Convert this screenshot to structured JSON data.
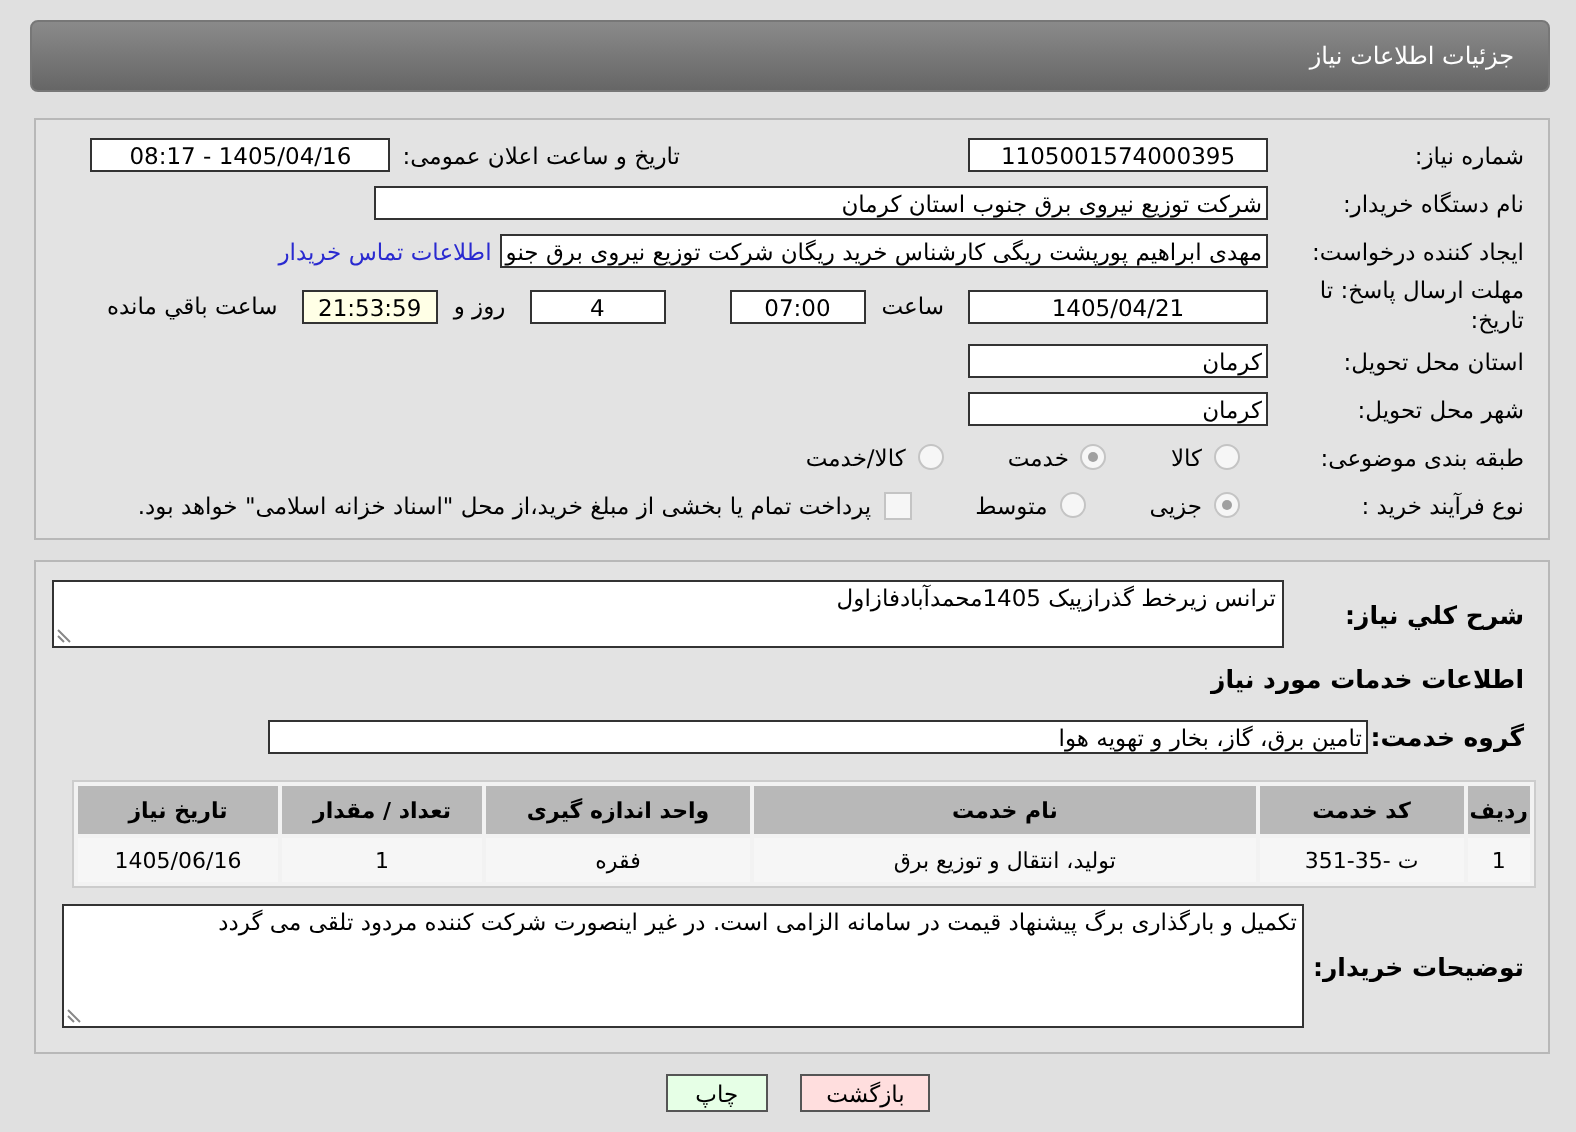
{
  "header": {
    "title": "جزئیات اطلاعات نیاز"
  },
  "need_number": {
    "label": "شماره نیاز:",
    "value": "1105001574000395"
  },
  "announce": {
    "label": "تاریخ و ساعت اعلان عمومی:",
    "value": "1405/04/16 - 08:17"
  },
  "buyer_org": {
    "label": "نام دستگاه خریدار:",
    "value": "شرکت توزیع نیروی برق جنوب استان کرمان"
  },
  "creator": {
    "label": "ایجاد کننده درخواست:",
    "value": "مهدی ابراهیم پورپشت ریگی کارشناس خرید ریگان شرکت توزیع نیروی برق جنو",
    "contact_link": "اطلاعات تماس خریدار"
  },
  "deadline": {
    "label": "مهلت ارسال پاسخ: تا تاریخ:",
    "date": "1405/04/21",
    "time_label": "ساعت",
    "time": "07:00",
    "days": "4",
    "days_label": "روز و",
    "remaining": "21:53:59",
    "remaining_label": "ساعت باقي مانده"
  },
  "province": {
    "label": "استان محل تحویل:",
    "value": "کرمان"
  },
  "city": {
    "label": "شهر محل تحویل:",
    "value": "کرمان"
  },
  "category": {
    "label": "طبقه بندی موضوعی:",
    "options": [
      {
        "label": "کالا",
        "selected": false
      },
      {
        "label": "خدمت",
        "selected": true
      },
      {
        "label": "کالا/خدمت",
        "selected": false
      }
    ]
  },
  "process": {
    "label": "نوع فرآیند خرید :",
    "options": [
      {
        "label": "جزیی",
        "selected": true
      },
      {
        "label": "متوسط",
        "selected": false
      }
    ],
    "treasury": {
      "label": "پرداخت تمام یا بخشی از مبلغ خرید،از محل \"اسناد خزانه اسلامی\" خواهد بود.",
      "checked": false
    }
  },
  "description": {
    "label": "شرح کلي نیاز:",
    "value": "ترانس زیرخط گذرازپیک 1405محمدآبادفازاول"
  },
  "services_heading": "اطلاعات خدمات مورد نیاز",
  "service_group": {
    "label": "گروه خدمت:",
    "value": "تامین برق، گاز، بخار و تهویه هوا"
  },
  "table": {
    "columns": [
      "ردیف",
      "کد خدمت",
      "نام خدمت",
      "واحد اندازه گیری",
      "تعداد / مقدار",
      "تاریخ نیاز"
    ],
    "rows": [
      [
        "1",
        "ت -35-351",
        "تولید، انتقال و توزیع برق",
        "فقره",
        "1",
        "1405/06/16"
      ]
    ]
  },
  "buyer_notes": {
    "label": "توضیحات خریدار:",
    "value": "تکمیل و بارگذاری برگ پیشنهاد قیمت در سامانه الزامی است. در غیر اینصورت شرکت کننده مردود تلقی می گردد"
  },
  "buttons": [
    {
      "label": "بازگشت",
      "kind": "back"
    },
    {
      "label": "چاپ",
      "kind": "print"
    }
  ]
}
